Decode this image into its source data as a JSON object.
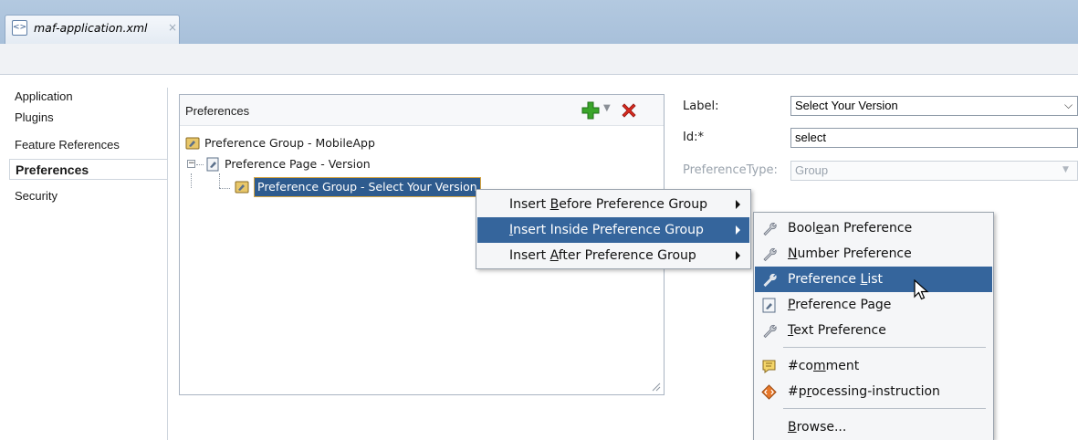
{
  "editor_tab": {
    "title": "maf-application.xml",
    "close_glyph": "×",
    "icon": "xml-file-icon"
  },
  "sidebar": {
    "items": [
      {
        "label": "Application"
      },
      {
        "label": "Plugins"
      },
      {
        "label": "Feature References"
      },
      {
        "label": "Preferences",
        "selected": true
      },
      {
        "label": "Security"
      }
    ]
  },
  "preferences_panel": {
    "title": "Preferences",
    "toolbar": {
      "add_icon": "green-plus-icon",
      "dropdown_icon": "chevron-down-icon",
      "delete_icon": "red-x-icon"
    },
    "tree": [
      {
        "label": "Preference Group - MobileApp",
        "icon": "preference-group-icon"
      },
      {
        "label": "Preference Page - Version",
        "icon": "preference-page-icon",
        "expanded": true,
        "expander": "−"
      },
      {
        "label": "Preference Group - Select Your Version",
        "icon": "preference-group-icon",
        "selected": true
      }
    ]
  },
  "form": {
    "label": {
      "caption": "Label:",
      "value": "Select Your Version"
    },
    "id": {
      "caption": "Id:*",
      "value": "select"
    },
    "preference_type": {
      "caption": "PreferenceType:",
      "value": "Group",
      "disabled": true
    }
  },
  "context_menu": {
    "items": [
      {
        "pre": "Insert ",
        "key": "B",
        "post": "efore Preference Group",
        "submenu": true
      },
      {
        "pre": "",
        "key": "I",
        "post": "nsert Inside Preference Group",
        "submenu": true,
        "highlighted": true
      },
      {
        "pre": "Insert ",
        "key": "A",
        "post": "fter Preference Group",
        "submenu": true
      }
    ]
  },
  "submenu": {
    "items": [
      {
        "pre": "Bool",
        "key": "e",
        "post": "an Preference",
        "icon": "wrench-icon"
      },
      {
        "pre": "",
        "key": "N",
        "post": "umber Preference",
        "icon": "wrench-icon"
      },
      {
        "pre": "Preference ",
        "key": "L",
        "post": "ist",
        "icon": "wrench-icon",
        "highlighted": true
      },
      {
        "pre": "",
        "key": "P",
        "post": "reference Page",
        "icon": "preference-page-icon"
      },
      {
        "pre": "",
        "key": "T",
        "post": "ext Preference",
        "icon": "wrench-icon"
      },
      {
        "pre": "#co",
        "key": "m",
        "post": "ment",
        "icon": "comment-icon"
      },
      {
        "pre": "#p",
        "key": "r",
        "post": "ocessing-instruction",
        "icon": "processing-instruction-icon"
      },
      {
        "pre": "",
        "key": "B",
        "post": "rowse...",
        "icon": ""
      }
    ]
  },
  "colors": {
    "tabstrip": "#a8c0da",
    "selection": "#35659c",
    "add_green": "#3aa52a",
    "delete_red": "#d8291e"
  }
}
